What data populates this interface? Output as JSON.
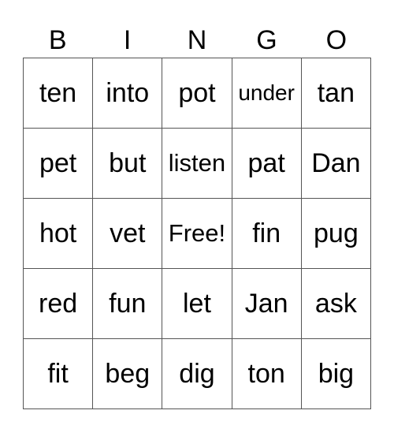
{
  "header": [
    "B",
    "I",
    "N",
    "G",
    "O"
  ],
  "rows": [
    [
      "ten",
      "into",
      "pot",
      "under",
      "tan"
    ],
    [
      "pet",
      "but",
      "listen",
      "pat",
      "Dan"
    ],
    [
      "hot",
      "vet",
      "Free!",
      "fin",
      "pug"
    ],
    [
      "red",
      "fun",
      "let",
      "Jan",
      "ask"
    ],
    [
      "fit",
      "beg",
      "dig",
      "ton",
      "big"
    ]
  ]
}
